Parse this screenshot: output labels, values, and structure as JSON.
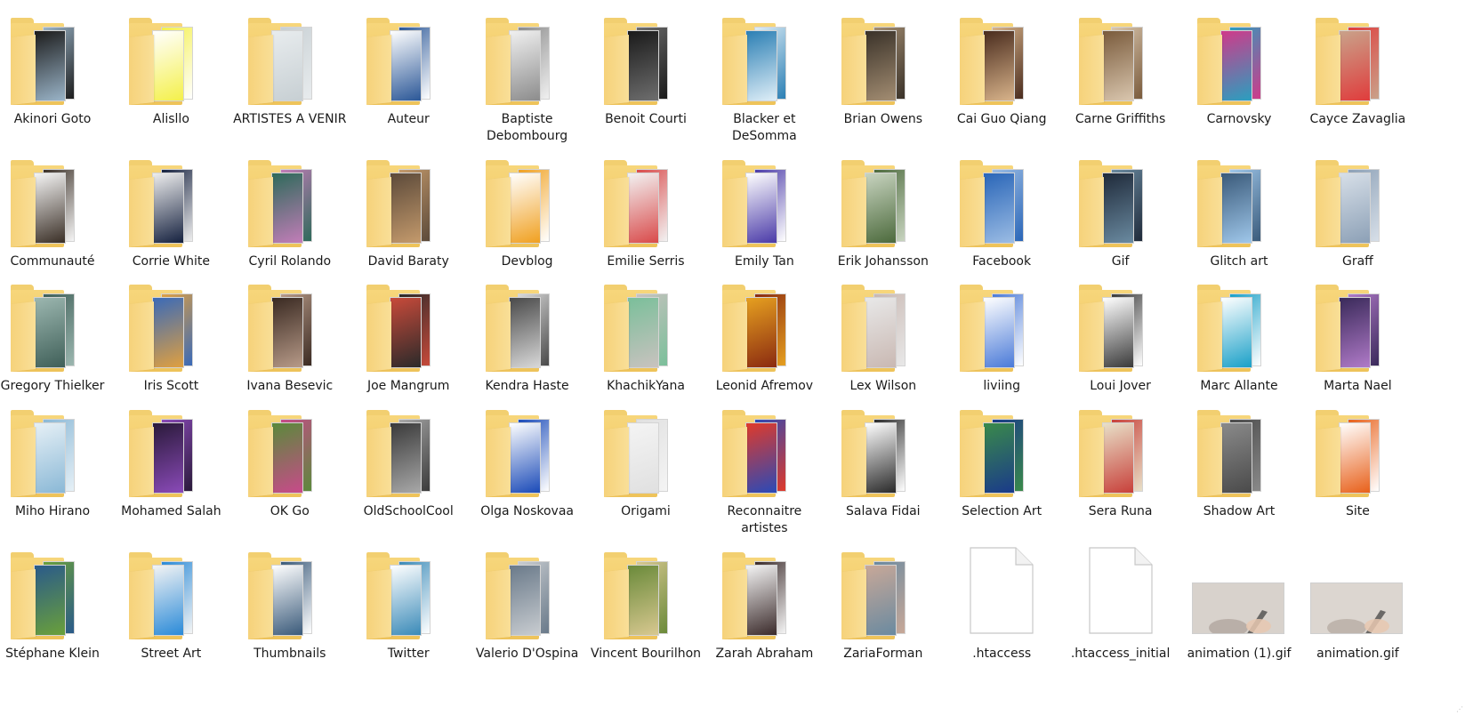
{
  "window": {
    "view": "large-icons"
  },
  "items": [
    {
      "name": "Akinori Goto",
      "type": "folder",
      "colors": [
        "#1c1c1c",
        "#9ab4c8"
      ]
    },
    {
      "name": "Alisllo",
      "type": "folder",
      "colors": [
        "#ffffff",
        "#f4f04a"
      ]
    },
    {
      "name": "ARTISTES A VENIR",
      "type": "folder",
      "colors": [
        "#e8ecee",
        "#c7cfd3"
      ]
    },
    {
      "name": "Auteur",
      "type": "folder",
      "colors": [
        "#ffffff",
        "#2b5797"
      ]
    },
    {
      "name": "Baptiste Debombourg",
      "type": "folder",
      "colors": [
        "#f0f0f0",
        "#8c8c8c"
      ]
    },
    {
      "name": "Benoit Courti",
      "type": "folder",
      "colors": [
        "#1a1a1a",
        "#6e6e6e"
      ]
    },
    {
      "name": "Blacker et DeSomma",
      "type": "folder",
      "colors": [
        "#2b7fb4",
        "#dfeef7"
      ]
    },
    {
      "name": "Brian Owens",
      "type": "folder",
      "colors": [
        "#3a3229",
        "#a38d72"
      ]
    },
    {
      "name": "Cai Guo Qiang",
      "type": "folder",
      "colors": [
        "#4a2c1e",
        "#d8b38a"
      ]
    },
    {
      "name": "Carne Griffiths",
      "type": "folder",
      "colors": [
        "#7a5b3c",
        "#d9c6ae"
      ]
    },
    {
      "name": "Carnovsky",
      "type": "folder",
      "colors": [
        "#d03a8a",
        "#2a9fbf"
      ]
    },
    {
      "name": "Cayce Zavaglia",
      "type": "folder",
      "colors": [
        "#c9a28a",
        "#e03c3c"
      ]
    },
    {
      "name": "Communauté",
      "type": "folder",
      "colors": [
        "#f5f5f5",
        "#3a2f26"
      ]
    },
    {
      "name": "Corrie White",
      "type": "folder",
      "colors": [
        "#eeeeee",
        "#15213f"
      ]
    },
    {
      "name": "Cyril Rolando",
      "type": "folder",
      "colors": [
        "#2e6a5a",
        "#c27db8"
      ]
    },
    {
      "name": "David Baraty",
      "type": "folder",
      "colors": [
        "#5c4a3a",
        "#c49a6c"
      ]
    },
    {
      "name": "Devblog",
      "type": "folder",
      "colors": [
        "#ffffff",
        "#f0a020"
      ]
    },
    {
      "name": "Emilie Serris",
      "type": "folder",
      "colors": [
        "#f2f2f2",
        "#d94a4a"
      ]
    },
    {
      "name": "Emily Tan",
      "type": "folder",
      "colors": [
        "#ffffff",
        "#4a3aa8"
      ]
    },
    {
      "name": "Erik Johansson",
      "type": "folder",
      "colors": [
        "#c8d4c0",
        "#4c6a3c"
      ]
    },
    {
      "name": "Facebook",
      "type": "folder",
      "colors": [
        "#2a66b8",
        "#9bbce4"
      ]
    },
    {
      "name": "Gif",
      "type": "folder",
      "colors": [
        "#1f2a3a",
        "#6a8aa0"
      ]
    },
    {
      "name": "Glitch art",
      "type": "folder",
      "colors": [
        "#3a5a7a",
        "#9fc7ea"
      ]
    },
    {
      "name": "Graff",
      "type": "folder",
      "colors": [
        "#d7dfe8",
        "#8ca0b6"
      ]
    },
    {
      "name": "Gregory Thielker",
      "type": "folder",
      "colors": [
        "#9cb7b0",
        "#3f5f58"
      ]
    },
    {
      "name": "Iris Scott",
      "type": "folder",
      "colors": [
        "#3a6ab8",
        "#e0a040"
      ]
    },
    {
      "name": "Ivana Besevic",
      "type": "folder",
      "colors": [
        "#3a2a22",
        "#b79a88"
      ]
    },
    {
      "name": "Joe Mangrum",
      "type": "folder",
      "colors": [
        "#c84a3a",
        "#2a2a2a"
      ]
    },
    {
      "name": "Kendra Haste",
      "type": "folder",
      "colors": [
        "#4a4a4a",
        "#d8d8d8"
      ]
    },
    {
      "name": "KhachikYana",
      "type": "folder",
      "colors": [
        "#7abf9a",
        "#c9c2bf"
      ]
    },
    {
      "name": "Leonid Afremov",
      "type": "folder",
      "colors": [
        "#e6a020",
        "#8a2a10"
      ]
    },
    {
      "name": "Lex Wilson",
      "type": "folder",
      "colors": [
        "#e8e8e8",
        "#c9b8b2"
      ]
    },
    {
      "name": "liviing",
      "type": "folder",
      "colors": [
        "#ffffff",
        "#4a7ad8"
      ]
    },
    {
      "name": "Loui Jover",
      "type": "folder",
      "colors": [
        "#ffffff",
        "#3a3a3a"
      ]
    },
    {
      "name": "Marc Allante",
      "type": "folder",
      "colors": [
        "#ffffff",
        "#1aa0c8"
      ]
    },
    {
      "name": "Marta Nael",
      "type": "folder",
      "colors": [
        "#3a2a5a",
        "#b07ac8"
      ]
    },
    {
      "name": "Miho Hirano",
      "type": "folder",
      "colors": [
        "#e6f0f6",
        "#8ab8d6"
      ]
    },
    {
      "name": "Mohamed Salah",
      "type": "folder",
      "colors": [
        "#2a1a3a",
        "#8a4ab8"
      ]
    },
    {
      "name": "OK Go",
      "type": "folder",
      "colors": [
        "#5a8a3a",
        "#c84a8a"
      ]
    },
    {
      "name": "OldSchoolCool",
      "type": "folder",
      "colors": [
        "#3a3a3a",
        "#a8a8a8"
      ]
    },
    {
      "name": "Olga Noskovaa",
      "type": "folder",
      "colors": [
        "#ffffff",
        "#1a4ab8"
      ]
    },
    {
      "name": "Origami",
      "type": "folder",
      "colors": [
        "#f4f4f4",
        "#e0e0e0"
      ]
    },
    {
      "name": "Reconnaitre artistes",
      "type": "folder",
      "colors": [
        "#e03a2a",
        "#2a4ab8"
      ]
    },
    {
      "name": "Salava Fidai",
      "type": "folder",
      "colors": [
        "#ffffff",
        "#2a2a2a"
      ]
    },
    {
      "name": "Selection Art",
      "type": "folder",
      "colors": [
        "#3a8a4a",
        "#1a3a8a"
      ]
    },
    {
      "name": "Sera Runa",
      "type": "folder",
      "colors": [
        "#e8e0c8",
        "#c8403a"
      ]
    },
    {
      "name": "Shadow Art",
      "type": "folder",
      "colors": [
        "#8a8a8a",
        "#4a4a4a"
      ]
    },
    {
      "name": "Site",
      "type": "folder",
      "colors": [
        "#ffffff",
        "#e8601a"
      ]
    },
    {
      "name": "Stéphane Klein",
      "type": "folder",
      "colors": [
        "#2a5a8a",
        "#6aa03a"
      ]
    },
    {
      "name": "Street Art",
      "type": "folder",
      "colors": [
        "#f4f4f4",
        "#2a8ad8"
      ]
    },
    {
      "name": "Thumbnails",
      "type": "folder",
      "colors": [
        "#ffffff",
        "#3a5a7a"
      ]
    },
    {
      "name": "Twitter",
      "type": "folder",
      "colors": [
        "#ffffff",
        "#3a8ab8"
      ]
    },
    {
      "name": "Valerio D'Ospina",
      "type": "folder",
      "colors": [
        "#6a7a8a",
        "#c8ccd0"
      ]
    },
    {
      "name": "Vincent Bourilhon",
      "type": "folder",
      "colors": [
        "#6a8a3a",
        "#d8c890"
      ]
    },
    {
      "name": "Zarah Abraham",
      "type": "folder",
      "colors": [
        "#f4f4f4",
        "#3a2a2a"
      ]
    },
    {
      "name": "ZariaForman",
      "type": "folder",
      "colors": [
        "#c8a898",
        "#6a8aa0"
      ]
    },
    {
      "name": ".htaccess",
      "type": "file"
    },
    {
      "name": ".htaccess_initial",
      "type": "file"
    },
    {
      "name": "animation (1).gif",
      "type": "gif",
      "colors": [
        "#d8d2cc",
        "#a0928a"
      ]
    },
    {
      "name": "animation.gif",
      "type": "gif",
      "colors": [
        "#dcd6d0",
        "#a89a90"
      ]
    }
  ]
}
